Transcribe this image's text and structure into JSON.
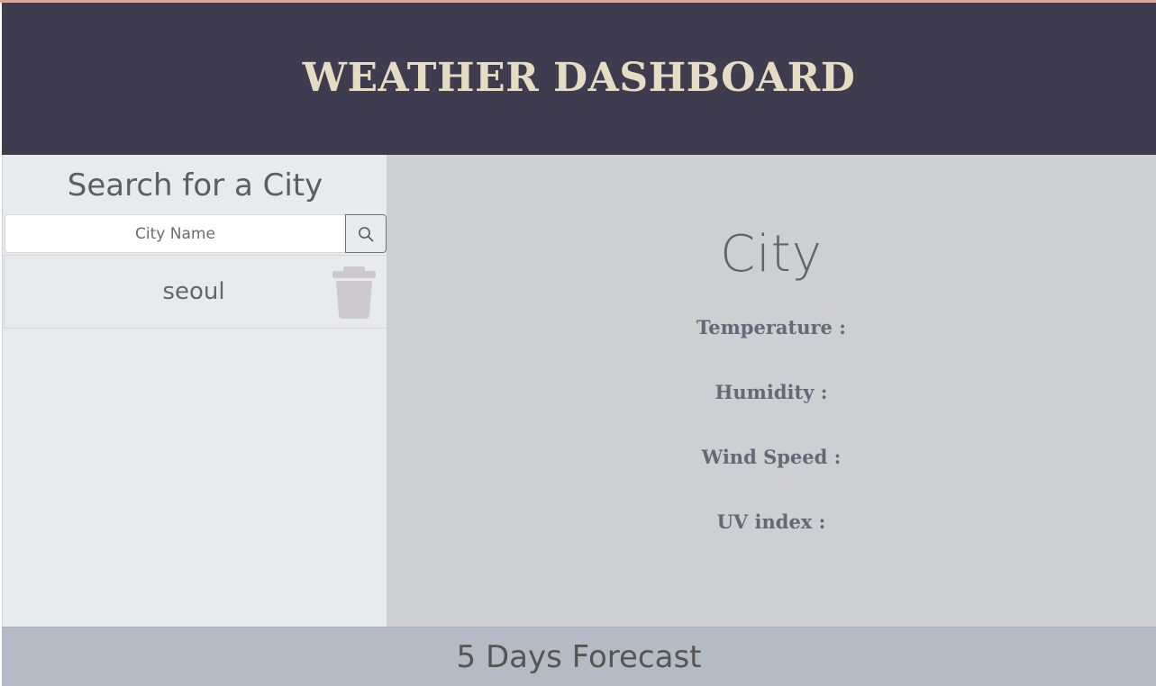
{
  "header": {
    "title": "WEATHER DASHBOARD"
  },
  "sidebar": {
    "title": "Search for a City",
    "search": {
      "placeholder": "City Name",
      "value": "",
      "button_icon": "search-icon"
    },
    "history": [
      {
        "label": "seoul",
        "delete_icon": "trash-icon"
      }
    ]
  },
  "current": {
    "city": "City",
    "temperature_label": "Temperature :",
    "humidity_label": "Humidity :",
    "wind_label": "Wind Speed :",
    "uv_label": "UV index :"
  },
  "forecast": {
    "title": "5 Days Forecast"
  },
  "colors": {
    "header_bg": "#3f3c50",
    "header_text": "#e6dcc4",
    "sidebar_bg": "#e8ebee",
    "main_bg": "#cdcfd3",
    "forecast_bg": "#b4bbc4"
  }
}
